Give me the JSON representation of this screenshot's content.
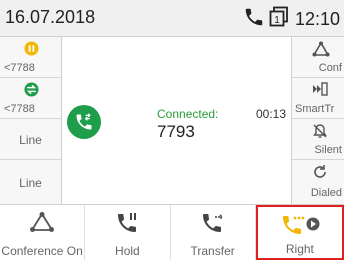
{
  "status": {
    "date": "16.07.2018",
    "time": "12:10"
  },
  "left_keys": [
    {
      "label": "<7788",
      "icon": "pause-icon",
      "color": "#f2b705"
    },
    {
      "label": "<7788",
      "icon": "swap-icon",
      "color": "#1e9e4a"
    },
    {
      "label": "Line"
    },
    {
      "label": "Line"
    }
  ],
  "right_keys": [
    {
      "label": "Conf",
      "icon": "conference-icon"
    },
    {
      "label": "SmartTr",
      "icon": "smart-transfer-icon"
    },
    {
      "label": "Silent",
      "icon": "silent-bell-icon"
    },
    {
      "label": "Dialed",
      "icon": "redial-icon"
    }
  ],
  "call": {
    "state": "Connected:",
    "duration": "00:13",
    "number": "7793"
  },
  "softkeys": [
    {
      "label": "Conference On",
      "icon": "conference-icon"
    },
    {
      "label": "Hold",
      "icon": "hold-icon"
    },
    {
      "label": "Transfer",
      "icon": "transfer-icon"
    },
    {
      "label": "Right",
      "icon": "right-arrow-icon"
    }
  ],
  "colors": {
    "accent_green": "#1e9e4a",
    "accent_yellow": "#f2b705",
    "highlight_red": "#e0201e"
  }
}
